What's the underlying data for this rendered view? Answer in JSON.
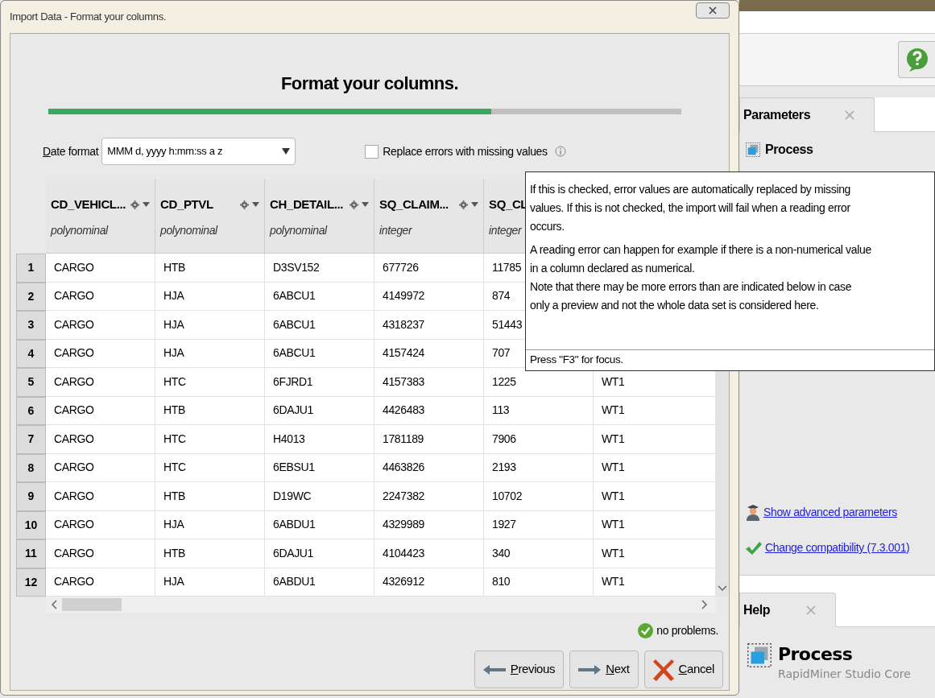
{
  "dialog": {
    "title": "Import Data - Format your columns.",
    "heading": "Format your columns.",
    "progress": {
      "level": 0.7
    },
    "date_format": {
      "label": "Date format",
      "value": "MMM d, yyyy h:mm:ss a z"
    },
    "replace_errors": {
      "label": "Replace errors with missing values",
      "checked": false
    },
    "table": {
      "columns": [
        {
          "kind": "full",
          "name": "CD_VEHICL...",
          "type": "polynominal"
        },
        {
          "kind": "full",
          "name": "CD_PTVL",
          "type": "polynominal"
        },
        {
          "kind": "full",
          "name": "CH_DETAIL...",
          "type": "polynominal"
        },
        {
          "kind": "full",
          "name": "SQ_CLAIM...",
          "type": "integer"
        },
        {
          "kind": "covered",
          "name": "SQ_CL",
          "type": "integer"
        }
      ],
      "rows": [
        {
          "index": "1",
          "cells": [
            "CARGO",
            "HTB",
            "D3SV152",
            "677726",
            "11785"
          ]
        },
        {
          "index": "2",
          "cells": [
            "CARGO",
            "HJA",
            "6ABCU1",
            "4149972",
            "874"
          ]
        },
        {
          "index": "3",
          "cells": [
            "CARGO",
            "HJA",
            "6ABCU1",
            "4318237",
            "51443"
          ]
        },
        {
          "index": "4",
          "cells": [
            "CARGO",
            "HJA",
            "6ABCU1",
            "4157424",
            "707"
          ]
        },
        {
          "index": "5",
          "cells": [
            "CARGO",
            "HTC",
            "6FJRD1",
            "4157383",
            "1225",
            "WT1"
          ]
        },
        {
          "index": "6",
          "cells": [
            "CARGO",
            "HTB",
            "6DAJU1",
            "4426483",
            "113",
            "WT1"
          ]
        },
        {
          "index": "7",
          "cells": [
            "CARGO",
            "HTC",
            "H4013",
            "1781189",
            "7906",
            "WT1"
          ]
        },
        {
          "index": "8",
          "cells": [
            "CARGO",
            "HTC",
            "6EBSU1",
            "4463826",
            "2193",
            "WT1"
          ]
        },
        {
          "index": "9",
          "cells": [
            "CARGO",
            "HTB",
            "D19WC",
            "2247382",
            "10702",
            "WT1"
          ]
        },
        {
          "index": "10",
          "cells": [
            "CARGO",
            "HJA",
            "6ABDU1",
            "4329989",
            "1927",
            "WT1"
          ]
        },
        {
          "index": "11",
          "cells": [
            "CARGO",
            "HTB",
            "6DAJU1",
            "4104423",
            "340",
            "WT1"
          ]
        },
        {
          "index": "12",
          "cells": [
            "CARGO",
            "HJA",
            "6ABDU1",
            "4326912",
            "810",
            "WT1"
          ]
        }
      ]
    },
    "status": "no problems.",
    "buttons": [
      {
        "kind": "previous",
        "label": "Previous"
      },
      {
        "kind": "next",
        "label": "Next"
      },
      {
        "kind": "cancel",
        "label": "Cancel"
      }
    ]
  },
  "tooltip": {
    "paragraphs": [
      "If this is checked, error values are automatically replaced by missing values. If this is not checked, the import will fail when a reading error occurs.",
      "A reading error can happen for example if there is a non-numerical value in a column declared as numerical.",
      "Note that there may be more errors than are indicated below in case only a preview and not the whole data set is considered here."
    ],
    "footer": "Press \"F3\" for focus."
  },
  "parameters": {
    "tab": "Parameters",
    "process": "Process",
    "links": [
      {
        "kind": "advanced",
        "label": "Show advanced parameters"
      },
      {
        "kind": "compatibility",
        "label": "Change compatibility (7.3.001)"
      }
    ]
  },
  "help": {
    "tab": "Help",
    "title": "Process",
    "subtitle": "RapidMiner Studio Core"
  }
}
